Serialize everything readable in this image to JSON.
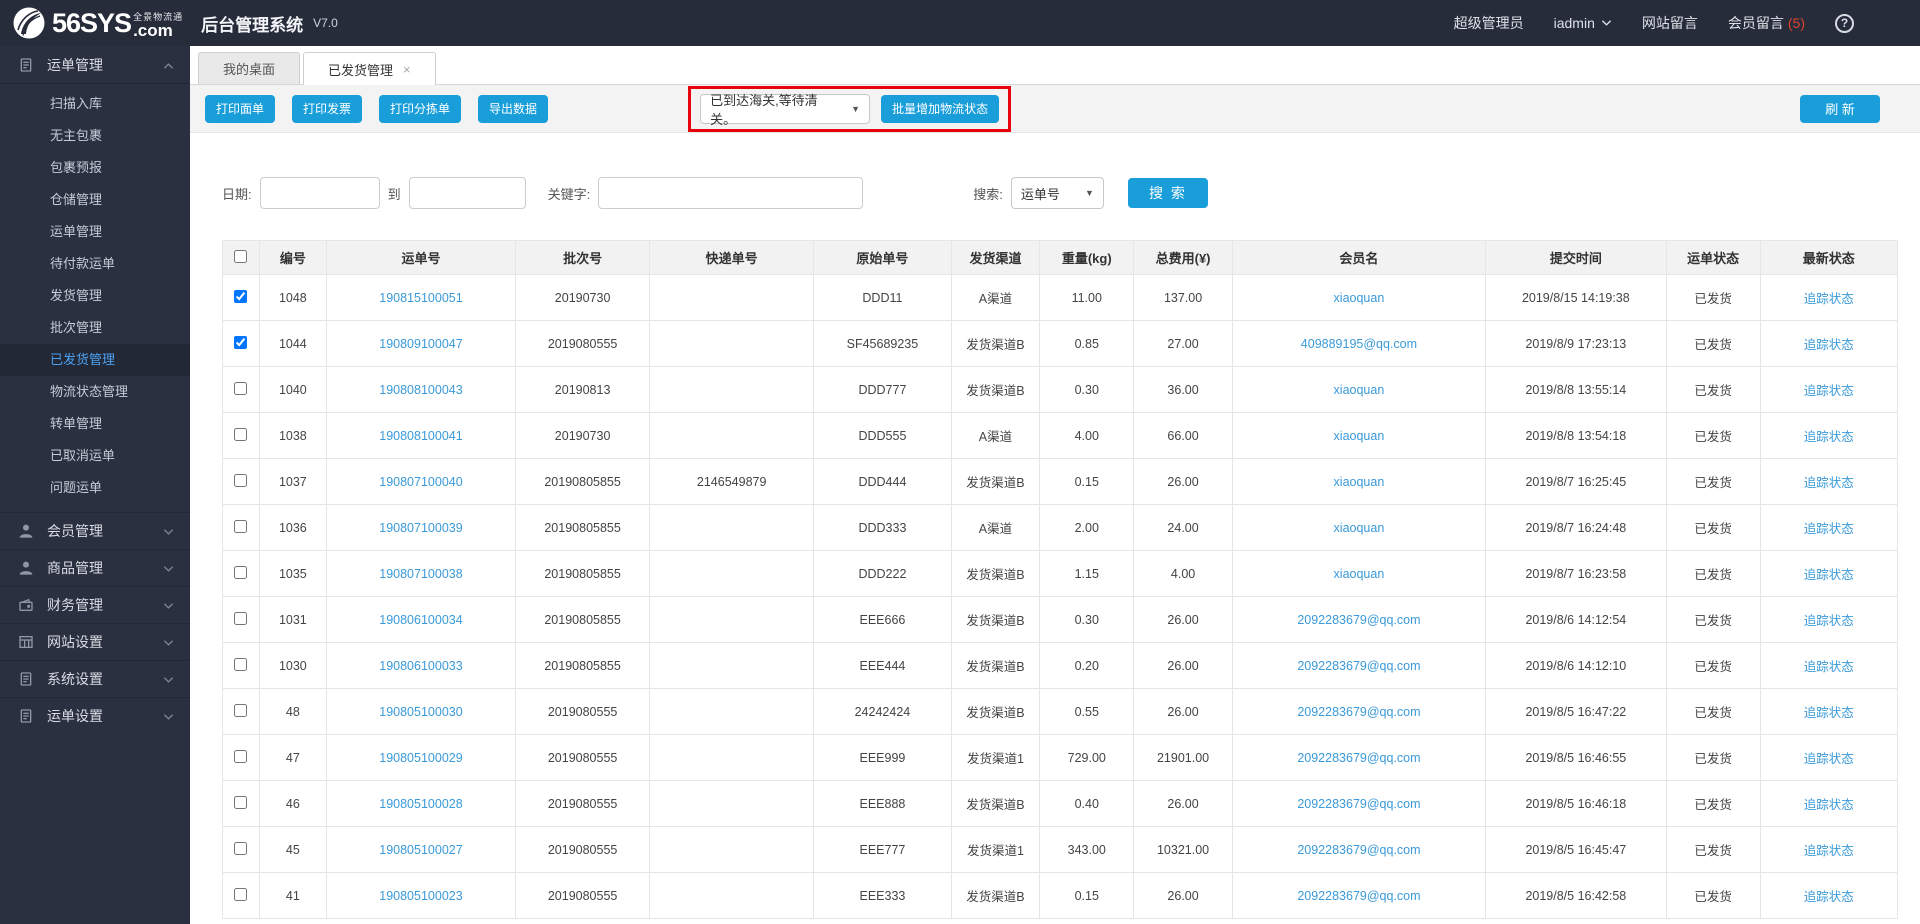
{
  "topbar": {
    "brand_big": "56SYS",
    "brand_cn": "全景物流通",
    "brand_com": ".com",
    "title": "后台管理系统",
    "version": "V7.0",
    "role": "超级管理员",
    "user": "iadmin",
    "site_msg": "网站留言",
    "member_msg": "会员留言",
    "member_msg_count": "(5)",
    "help": "?"
  },
  "sidebar": {
    "active": "已发货管理",
    "sections": [
      {
        "label": "运单管理",
        "icon": "clipboard",
        "chevron": "up",
        "items": [
          "扫描入库",
          "无主包裹",
          "包裹预报",
          "仓储管理",
          "运单管理",
          "待付款运单",
          "发货管理",
          "批次管理",
          "已发货管理",
          "物流状态管理",
          "转单管理",
          "已取消运单",
          "问题运单"
        ]
      },
      {
        "label": "会员管理",
        "icon": "user",
        "chevron": "down",
        "items": []
      },
      {
        "label": "商品管理",
        "icon": "user",
        "chevron": "down",
        "items": []
      },
      {
        "label": "财务管理",
        "icon": "wallet",
        "chevron": "down",
        "items": []
      },
      {
        "label": "网站设置",
        "icon": "grid",
        "chevron": "down",
        "items": []
      },
      {
        "label": "系统设置",
        "icon": "clipboard",
        "chevron": "down",
        "items": []
      },
      {
        "label": "运单设置",
        "icon": "clipboard",
        "chevron": "down",
        "items": []
      }
    ]
  },
  "tabs": [
    {
      "label": "我的桌面",
      "active": false
    },
    {
      "label": "已发货管理",
      "active": true,
      "close": "×"
    }
  ],
  "toolbar": {
    "print_sheet": "打印面单",
    "print_invoice": "打印发票",
    "print_sorting": "打印分拣单",
    "export_data": "导出数据",
    "status_value": "已到达海关,等待清关。",
    "batch_add": "批量增加物流状态",
    "refresh": "刷 新"
  },
  "search": {
    "date_label": "日期:",
    "to_label": "到",
    "keyword_label": "关键字:",
    "search_label": "搜索:",
    "type_value": "运单号",
    "button": "搜 索"
  },
  "table": {
    "headers": [
      "编号",
      "运单号",
      "批次号",
      "快递单号",
      "原始单号",
      "发货渠道",
      "重量(kg)",
      "总费用(¥)",
      "会员名",
      "提交时间",
      "运单状态",
      "最新状态"
    ],
    "rows": [
      {
        "checked": true,
        "id": "1048",
        "waybill": "190815100051",
        "batch": "20190730",
        "express": "",
        "original": "DDD11",
        "channel": "A渠道",
        "weight": "11.00",
        "fee": "137.00",
        "member": "xiaoquan",
        "time": "2019/8/15 14:19:38",
        "status": "已发货",
        "latest": "追踪状态"
      },
      {
        "checked": true,
        "id": "1044",
        "waybill": "190809100047",
        "batch": "2019080555",
        "express": "",
        "original": "SF45689235",
        "channel": "发货渠道B",
        "weight": "0.85",
        "fee": "27.00",
        "member": "409889195@qq.com",
        "time": "2019/8/9 17:23:13",
        "status": "已发货",
        "latest": "追踪状态"
      },
      {
        "checked": false,
        "id": "1040",
        "waybill": "190808100043",
        "batch": "20190813",
        "express": "",
        "original": "DDD777",
        "channel": "发货渠道B",
        "weight": "0.30",
        "fee": "36.00",
        "member": "xiaoquan",
        "time": "2019/8/8 13:55:14",
        "status": "已发货",
        "latest": "追踪状态"
      },
      {
        "checked": false,
        "id": "1038",
        "waybill": "190808100041",
        "batch": "20190730",
        "express": "",
        "original": "DDD555",
        "channel": "A渠道",
        "weight": "4.00",
        "fee": "66.00",
        "member": "xiaoquan",
        "time": "2019/8/8 13:54:18",
        "status": "已发货",
        "latest": "追踪状态"
      },
      {
        "checked": false,
        "id": "1037",
        "waybill": "190807100040",
        "batch": "20190805855",
        "express": "2146549879",
        "original": "DDD444",
        "channel": "发货渠道B",
        "weight": "0.15",
        "fee": "26.00",
        "member": "xiaoquan",
        "time": "2019/8/7 16:25:45",
        "status": "已发货",
        "latest": "追踪状态"
      },
      {
        "checked": false,
        "id": "1036",
        "waybill": "190807100039",
        "batch": "20190805855",
        "express": "",
        "original": "DDD333",
        "channel": "A渠道",
        "weight": "2.00",
        "fee": "24.00",
        "member": "xiaoquan",
        "time": "2019/8/7 16:24:48",
        "status": "已发货",
        "latest": "追踪状态"
      },
      {
        "checked": false,
        "id": "1035",
        "waybill": "190807100038",
        "batch": "20190805855",
        "express": "",
        "original": "DDD222",
        "channel": "发货渠道B",
        "weight": "1.15",
        "fee": "4.00",
        "member": "xiaoquan",
        "time": "2019/8/7 16:23:58",
        "status": "已发货",
        "latest": "追踪状态"
      },
      {
        "checked": false,
        "id": "1031",
        "waybill": "190806100034",
        "batch": "20190805855",
        "express": "",
        "original": "EEE666",
        "channel": "发货渠道B",
        "weight": "0.30",
        "fee": "26.00",
        "member": "2092283679@qq.com",
        "time": "2019/8/6 14:12:54",
        "status": "已发货",
        "latest": "追踪状态"
      },
      {
        "checked": false,
        "id": "1030",
        "waybill": "190806100033",
        "batch": "20190805855",
        "express": "",
        "original": "EEE444",
        "channel": "发货渠道B",
        "weight": "0.20",
        "fee": "26.00",
        "member": "2092283679@qq.com",
        "time": "2019/8/6 14:12:10",
        "status": "已发货",
        "latest": "追踪状态"
      },
      {
        "checked": false,
        "id": "48",
        "waybill": "190805100030",
        "batch": "2019080555",
        "express": "",
        "original": "24242424",
        "channel": "发货渠道B",
        "weight": "0.55",
        "fee": "26.00",
        "member": "2092283679@qq.com",
        "time": "2019/8/5 16:47:22",
        "status": "已发货",
        "latest": "追踪状态"
      },
      {
        "checked": false,
        "id": "47",
        "waybill": "190805100029",
        "batch": "2019080555",
        "express": "",
        "original": "EEE999",
        "channel": "发货渠道1",
        "weight": "729.00",
        "fee": "21901.00",
        "member": "2092283679@qq.com",
        "time": "2019/8/5 16:46:55",
        "status": "已发货",
        "latest": "追踪状态"
      },
      {
        "checked": false,
        "id": "46",
        "waybill": "190805100028",
        "batch": "2019080555",
        "express": "",
        "original": "EEE888",
        "channel": "发货渠道B",
        "weight": "0.40",
        "fee": "26.00",
        "member": "2092283679@qq.com",
        "time": "2019/8/5 16:46:18",
        "status": "已发货",
        "latest": "追踪状态"
      },
      {
        "checked": false,
        "id": "45",
        "waybill": "190805100027",
        "batch": "2019080555",
        "express": "",
        "original": "EEE777",
        "channel": "发货渠道1",
        "weight": "343.00",
        "fee": "10321.00",
        "member": "2092283679@qq.com",
        "time": "2019/8/5 16:45:47",
        "status": "已发货",
        "latest": "追踪状态"
      },
      {
        "checked": false,
        "id": "41",
        "waybill": "190805100023",
        "batch": "2019080555",
        "express": "",
        "original": "EEE333",
        "channel": "发货渠道B",
        "weight": "0.15",
        "fee": "26.00",
        "member": "2092283679@qq.com",
        "time": "2019/8/5 16:42:58",
        "status": "已发货",
        "latest": "追踪状态"
      }
    ]
  },
  "colors": {
    "accent_blue": "#1a9eda",
    "link_blue": "#3a9ad9",
    "annotation_red": "#e8000d",
    "topbar_bg": "#262c3a",
    "sidebar_bg": "#2a3040",
    "sidebar_active_text": "#4da0f0"
  }
}
